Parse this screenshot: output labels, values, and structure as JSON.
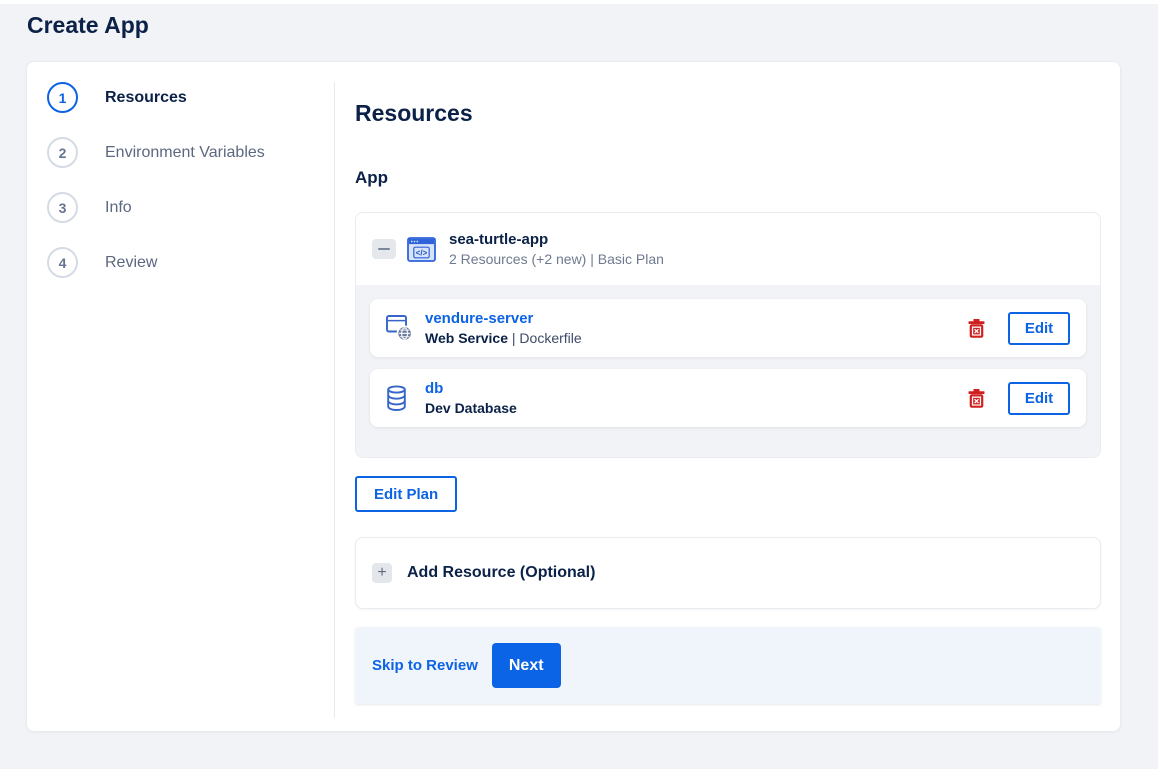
{
  "page": {
    "title": "Create App"
  },
  "stepper": {
    "steps": [
      {
        "num": "1",
        "label": "Resources",
        "active": true
      },
      {
        "num": "2",
        "label": "Environment Variables",
        "active": false
      },
      {
        "num": "3",
        "label": "Info",
        "active": false
      },
      {
        "num": "4",
        "label": "Review",
        "active": false
      }
    ]
  },
  "content": {
    "heading": "Resources",
    "section_label": "App",
    "app": {
      "name": "sea-turtle-app",
      "meta": "2 Resources (+2 new) | Basic Plan",
      "resources": [
        {
          "name": "vendure-server",
          "type": "Web Service",
          "detail": "| Dockerfile",
          "edit_label": "Edit"
        },
        {
          "name": "db",
          "type": "Dev Database",
          "detail": "",
          "edit_label": "Edit"
        }
      ]
    },
    "edit_plan_label": "Edit Plan",
    "add_resource_label": "Add Resource (Optional)",
    "footer": {
      "skip_label": "Skip to Review",
      "next_label": "Next"
    }
  },
  "colors": {
    "accent_blue": "#0c63e4",
    "dark_navy": "#0b2147",
    "danger_red": "#cf2020",
    "page_bg": "#f1f3f6",
    "footer_bg": "#f0f5fc"
  }
}
